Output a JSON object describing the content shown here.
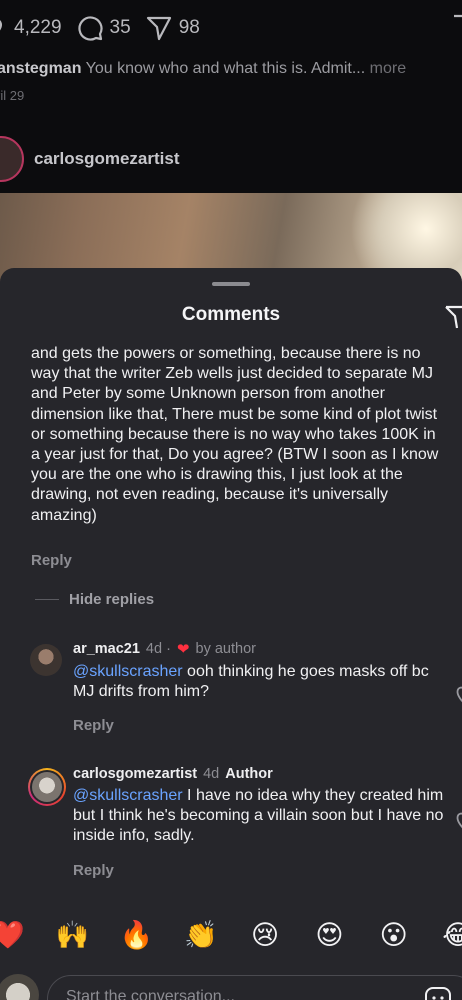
{
  "background_post": {
    "likes": "4,229",
    "comments": "35",
    "shares": "98",
    "caption_user": "anstegman",
    "caption_text": " You know who and what this is. Admit...",
    "caption_more": " more",
    "date": "ril 29",
    "next_user": "carlosgomezartist"
  },
  "sheet": {
    "title": "Comments"
  },
  "main_comment": {
    "text": "and gets the powers or something, because there is no way that the writer Zeb wells just decided to separate MJ and Peter by some Unknown person from another dimension like that, There must be some kind of plot twist or something because there is no way who takes 100K in a year just for that, Do you agree? (BTW I soon as I know you are the one who is drawing this, I just look at the drawing, not even reading, because it's universally amazing)",
    "reply_label": "Reply",
    "hide_replies_label": "Hide replies"
  },
  "replies": [
    {
      "username": "ar_mac21",
      "time": "4d ·",
      "heart": "❤",
      "liked_by": "by author",
      "mention": "@skullscrasher",
      "text": " ooh thinking he goes masks off bc MJ drifts from him?",
      "reply_label": "Reply"
    },
    {
      "username": "carlosgomezartist",
      "time": "4d",
      "badge": "Author",
      "mention": "@skullscrasher",
      "text": " I have no idea why they created him but I think he's becoming a villain soon but I have no inside info, sadly.",
      "reply_label": "Reply"
    }
  ],
  "emoji_bar": [
    "❤️",
    "🙌",
    "🔥",
    "👏",
    "😢",
    "😍",
    "😮",
    "😂"
  ],
  "input": {
    "placeholder": "Start the conversation..."
  },
  "colors": {
    "sheet_bg": "#26262b",
    "mention": "#6aa3ff",
    "heart": "#ff3040",
    "muted": "#8d8d93"
  }
}
